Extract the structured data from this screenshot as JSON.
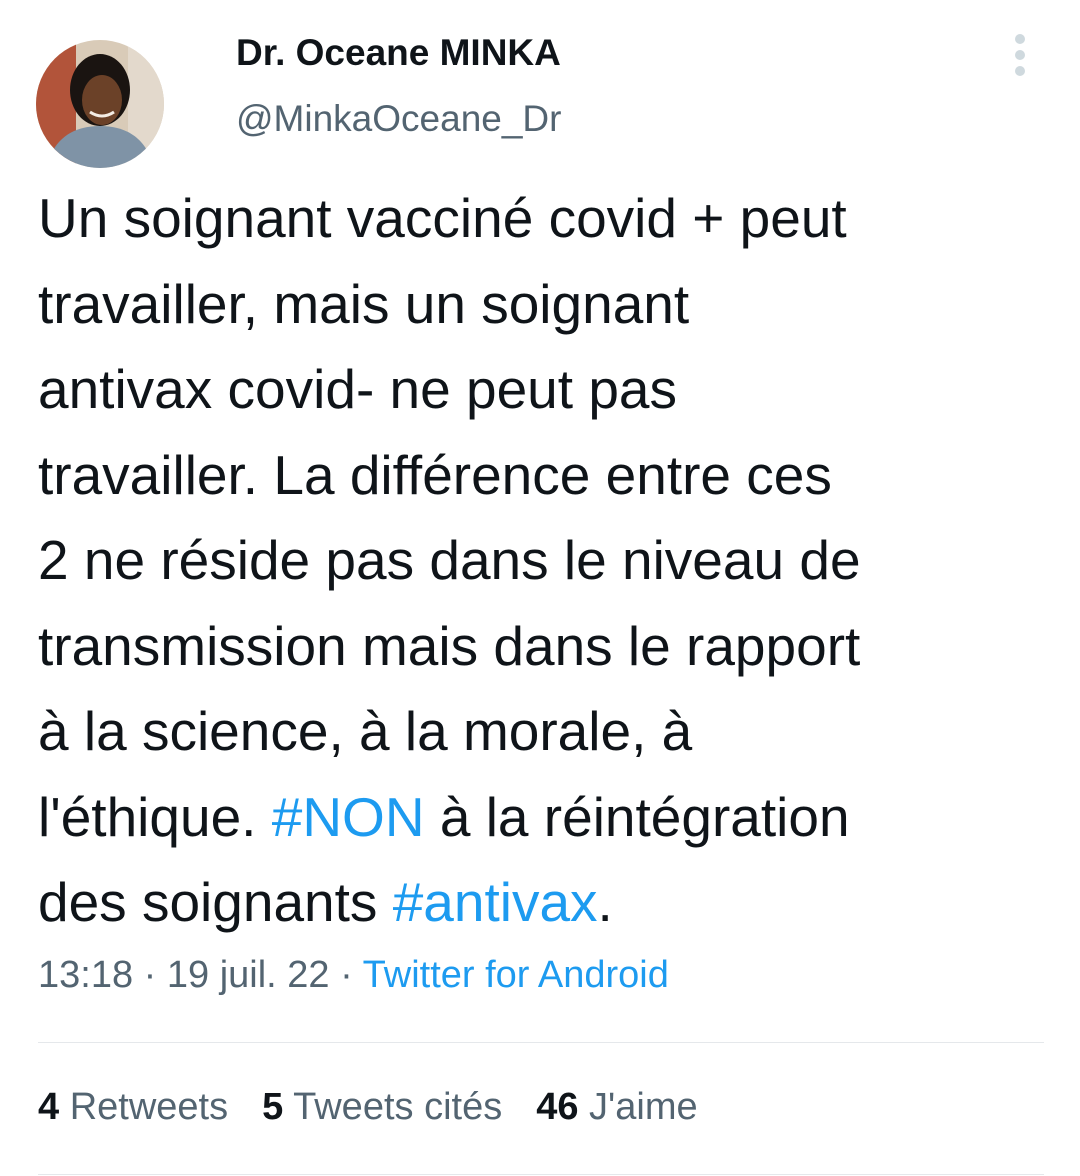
{
  "author": {
    "name": "Dr. Oceane MINKA",
    "handle": "@MinkaOceane_Dr"
  },
  "tweet": {
    "lines": [
      [
        {
          "text": "Un soignant vacciné covid + peut"
        }
      ],
      [
        {
          "text": "travailler, mais un soignant"
        }
      ],
      [
        {
          "text": "antivax covid- ne peut pas"
        }
      ],
      [
        {
          "text": "travailler. La différence entre ces"
        }
      ],
      [
        {
          "text": "2 ne réside pas dans le niveau de"
        }
      ],
      [
        {
          "text": "transmission mais dans le rapport"
        }
      ],
      [
        {
          "text": "à la science, à la morale, à"
        }
      ],
      [
        {
          "text": "l'éthique. "
        },
        {
          "text": "#NON",
          "hashtag": true
        },
        {
          "text": " à la réintégration"
        }
      ],
      [
        {
          "text": "des soignants "
        },
        {
          "text": "#antivax",
          "hashtag": true
        },
        {
          "text": "."
        }
      ]
    ],
    "time": "13:18",
    "date": "19 juil. 22",
    "separator": " · ",
    "source": "Twitter for Android"
  },
  "stats": {
    "retweets_count": "4",
    "retweets_label": "Retweets",
    "quotes_count": "5",
    "quotes_label": "Tweets cités",
    "likes_count": "46",
    "likes_label": "J'aime"
  },
  "colors": {
    "link": "#1d9bf0",
    "secondary": "#536471",
    "primary": "#0f1419"
  },
  "icons": {
    "menu": "more-vertical-icon"
  }
}
